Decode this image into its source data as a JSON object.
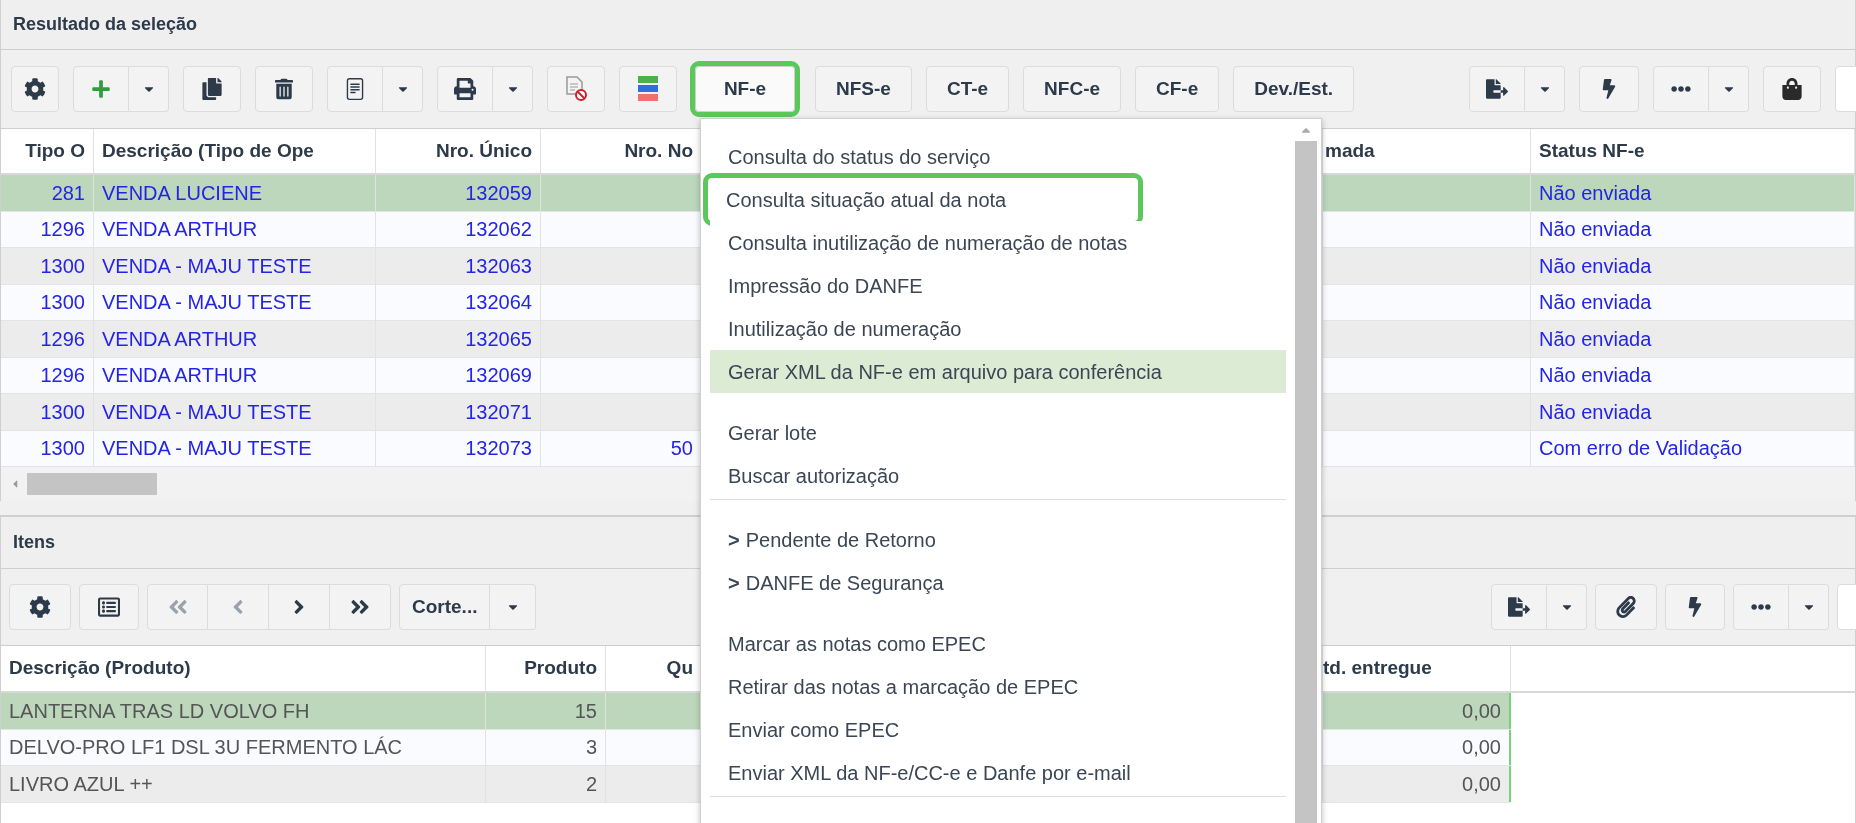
{
  "upper_panel": {
    "title": "Resultado da seleção",
    "toolbar_buttons": [
      {
        "label": "NF-e",
        "active": true,
        "annotated": true
      },
      {
        "label": "NFS-e",
        "active": false,
        "annotated": false
      },
      {
        "label": "CT-e",
        "active": false,
        "annotated": false
      },
      {
        "label": "NFC-e",
        "active": false,
        "annotated": false
      },
      {
        "label": "CF-e",
        "active": false,
        "annotated": false
      },
      {
        "label": "Dev./Est.",
        "active": false,
        "annotated": false
      }
    ],
    "table": {
      "columns": [
        "Tipo O",
        "Descrição (Tipo de Ope",
        "Nro. Único",
        "Nro. No",
        "mada",
        "Status NF-e"
      ],
      "rows": [
        {
          "selected": true,
          "tipo_o": "281",
          "descricao": "VENDA LUCIENE",
          "nro_unico": "132059",
          "status": "Não enviada"
        },
        {
          "selected": false,
          "tipo_o": "1296",
          "descricao": "VENDA ARTHUR",
          "nro_unico": "132062",
          "status": "Não enviada"
        },
        {
          "selected": false,
          "tipo_o": "1300",
          "descricao": "VENDA - MAJU TESTE",
          "nro_unico": "132063",
          "status": "Não enviada"
        },
        {
          "selected": false,
          "tipo_o": "1300",
          "descricao": "VENDA - MAJU TESTE",
          "nro_unico": "132064",
          "status": "Não enviada"
        },
        {
          "selected": false,
          "tipo_o": "1296",
          "descricao": "VENDA ARTHUR",
          "nro_unico": "132065",
          "status": "Não enviada"
        },
        {
          "selected": false,
          "tipo_o": "1296",
          "descricao": "VENDA ARTHUR",
          "nro_unico": "132069",
          "status": "Não enviada"
        },
        {
          "selected": false,
          "tipo_o": "1300",
          "descricao": "VENDA - MAJU TESTE",
          "nro_unico": "132071",
          "status": "Não enviada"
        },
        {
          "selected": false,
          "tipo_o": "1300",
          "descricao": "VENDA - MAJU TESTE",
          "nro_unico": "132073",
          "nro_no": "50",
          "status": "Com erro de Validação"
        }
      ]
    }
  },
  "lower_panel": {
    "title": "Itens",
    "split_button": {
      "label": "Corte..."
    },
    "table": {
      "columns": [
        "Descrição (Produto)",
        "Produto",
        "Qu",
        "td. entregue"
      ],
      "rows": [
        {
          "selected": true,
          "descricao": "LANTERNA TRAS LD VOLVO FH",
          "produto": "15",
          "qtd_entregue": "0,00"
        },
        {
          "selected": false,
          "descricao": "DELVO-PRO LF1 DSL 3U FERMENTO LÁC",
          "produto": "3",
          "qtd_entregue": "0,00"
        },
        {
          "selected": false,
          "descricao": "LIVRO AZUL ++",
          "produto": "2",
          "qtd_entregue": "0,00"
        }
      ]
    }
  },
  "nfe_menu": {
    "groups": [
      {
        "divider": false,
        "items": [
          {
            "kind": "action",
            "label": "Consulta do status do serviço",
            "selected": false,
            "annotated": false
          },
          {
            "kind": "action",
            "label": "Consulta situação atual da nota",
            "selected": false,
            "annotated": true
          },
          {
            "kind": "action",
            "label": "Consulta inutilização de numeração de notas",
            "selected": false,
            "annotated": false
          },
          {
            "kind": "action",
            "label": "Impressão do DANFE",
            "selected": false,
            "annotated": false
          },
          {
            "kind": "action",
            "label": "Inutilização de numeração",
            "selected": false,
            "annotated": false
          },
          {
            "kind": "action",
            "label": "Gerar XML da NF-e em arquivo para conferência",
            "selected": true,
            "annotated": false
          }
        ]
      },
      {
        "divider": true,
        "items": [
          {
            "kind": "action",
            "label": "Gerar lote",
            "selected": false,
            "annotated": false
          },
          {
            "kind": "action",
            "label": "Buscar autorização",
            "selected": false,
            "annotated": false
          }
        ]
      },
      {
        "divider": false,
        "items": [
          {
            "kind": "submenu",
            "marker": ">",
            "label": "Pendente de Retorno",
            "selected": false,
            "annotated": false
          },
          {
            "kind": "submenu",
            "marker": ">",
            "label": "DANFE de Segurança",
            "selected": false,
            "annotated": false
          }
        ]
      },
      {
        "divider": true,
        "items": [
          {
            "kind": "action",
            "label": "Marcar as notas como EPEC",
            "selected": false,
            "annotated": false
          },
          {
            "kind": "action",
            "label": "Retirar das notas a marcação de EPEC",
            "selected": false,
            "annotated": false
          },
          {
            "kind": "action",
            "label": "Enviar como EPEC",
            "selected": false,
            "annotated": false
          },
          {
            "kind": "action",
            "label": "Enviar XML da NF-e/CC-e e Danfe por e-mail",
            "selected": false,
            "annotated": false
          }
        ]
      }
    ]
  }
}
